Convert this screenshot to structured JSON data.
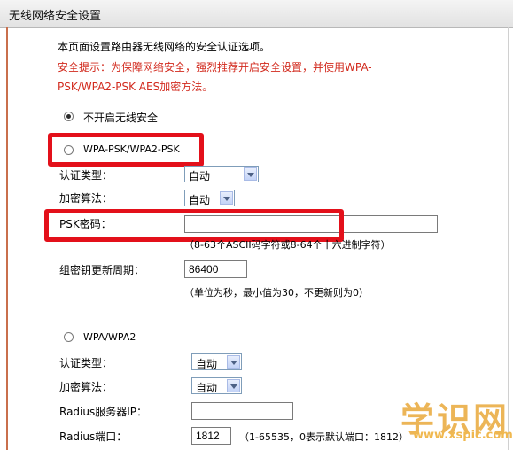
{
  "window": {
    "title": "无线网络安全设置"
  },
  "intro": {
    "line1": "本页面设置路由器无线网络的安全认证选项。",
    "line2": "安全提示：为保障网络安全，强烈推荐开启安全设置，并使用WPA-",
    "line3": "PSK/WPA2-PSK AES加密方法。"
  },
  "options": {
    "none": {
      "label": "不开启无线安全",
      "selected": true
    },
    "wpa_psk": {
      "label": "WPA-PSK/WPA2-PSK",
      "selected": false
    },
    "wpa": {
      "label": "WPA/WPA2",
      "selected": false
    }
  },
  "psk_section": {
    "auth_label": "认证类型：",
    "auth_value": "自动",
    "enc_label": "加密算法：",
    "enc_value": "自动",
    "psk_label": "PSK密码：",
    "psk_value": "",
    "psk_hint": "（8-63个ASCII码字符或8-64个十六进制字符）",
    "rekey_label": "组密钥更新周期：",
    "rekey_value": "86400",
    "rekey_hint": "（单位为秒，最小值为30，不更新则为0）"
  },
  "wpa_section": {
    "auth_label": "认证类型：",
    "auth_value": "自动",
    "enc_label": "加密算法：",
    "enc_value": "自动",
    "radius_ip_label": "Radius服务器IP：",
    "radius_ip_value": "",
    "radius_port_label": "Radius端口：",
    "radius_port_value": "1812",
    "radius_port_hint": "（1-65535，0表示默认端口：1812）"
  },
  "watermark": {
    "text": "学识网",
    "url": "www.xspic.com"
  },
  "colors": {
    "highlight": "#e3101a",
    "warning": "#d22a1e",
    "frame": "#c96f4c"
  }
}
